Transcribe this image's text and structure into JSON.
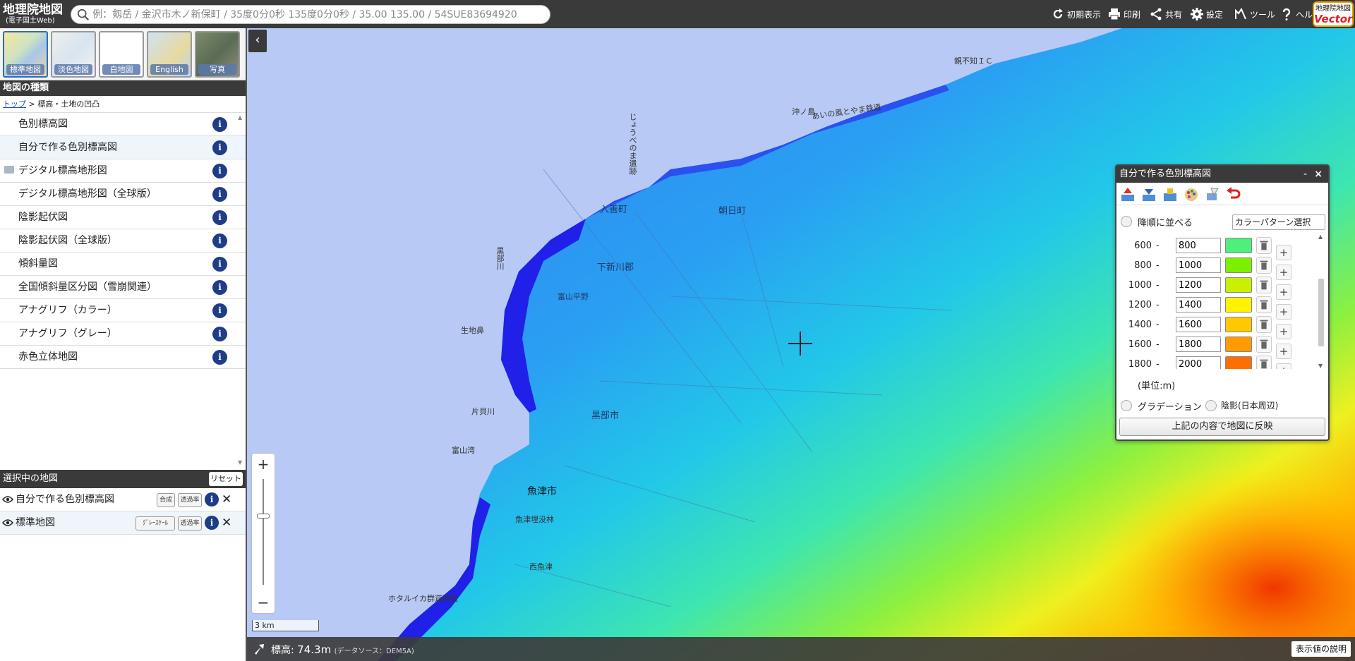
{
  "header": {
    "logo_line1": "地理院地図",
    "logo_line2": "(電子国土Web)",
    "search_placeholder": "例：剱岳 / 金沢市木ノ新保町 / 35度0分0秒 135度0分0秒 / 35.00 135.00 / 54SUE83694920",
    "buttons": [
      {
        "label": "初期表示",
        "icon": "reload-icon"
      },
      {
        "label": "印刷",
        "icon": "printer-icon"
      },
      {
        "label": "共有",
        "icon": "share-icon"
      },
      {
        "label": "設定",
        "icon": "gear-icon"
      },
      {
        "label": "ツール",
        "icon": "tools-icon"
      },
      {
        "label": "ヘルプ",
        "icon": "help-icon"
      }
    ],
    "vector_line1": "地理院地図",
    "vector_line2": "Vector"
  },
  "basemaps": [
    {
      "label": "標準地図",
      "active": true
    },
    {
      "label": "淡色地図",
      "active": false
    },
    {
      "label": "白地図",
      "active": false
    },
    {
      "label": "English",
      "active": false
    },
    {
      "label": "写真",
      "active": false
    }
  ],
  "maptype": {
    "header": "地図の種類",
    "breadcrumb_link": "トップ",
    "breadcrumb_rest": " > 標高・土地の凹凸",
    "items": [
      {
        "label": "色別標高図"
      },
      {
        "label": "自分で作る色別標高図"
      },
      {
        "label": "デジタル標高地形図"
      },
      {
        "label": "デジタル標高地形図（全球版）"
      },
      {
        "label": "陰影起伏図"
      },
      {
        "label": "陰影起伏図（全球版）"
      },
      {
        "label": "傾斜量図"
      },
      {
        "label": "全国傾斜量区分図（雪崩関連）"
      },
      {
        "label": "アナグリフ（カラー）"
      },
      {
        "label": "アナグリフ（グレー）"
      },
      {
        "label": "赤色立体地図"
      }
    ],
    "info_glyph": "i"
  },
  "selected": {
    "header": "選択中の地図",
    "reset_label": "リセット",
    "rows": [
      {
        "label": "自分で作る色別標高図",
        "btn1": "合成",
        "btn2": "透過率"
      },
      {
        "label": "標準地図",
        "btn1": "ｸﾞﾚｰｽｹｰﾙ",
        "btn2": "透過率"
      }
    ],
    "close_glyph": "✕"
  },
  "map": {
    "labels": [
      "親不知ＩＣ",
      "沖ノ島",
      "あいの風とやま鉄道",
      "じょうべのま遺跡",
      "入善町",
      "朝日町",
      "下新川郡",
      "富山平野",
      "黒部川",
      "生地鼻",
      "片貝川",
      "黒部市",
      "富山湾",
      "魚津市",
      "魚津埋没林",
      "西魚津",
      "ホタルイカ群遊海面"
    ],
    "scale_label": "3 km",
    "collapse_glyph": "‹"
  },
  "zoom": {
    "plus": "+",
    "minus": "−"
  },
  "status": {
    "label": "標高:",
    "value": "74.3m",
    "source": "(データソース：DEM5A)",
    "explain_label": "表示値の説明"
  },
  "dialog": {
    "title": "自分で作る色別標高図",
    "minimize": "-",
    "close": "×",
    "tool_icons": [
      "upload-icon",
      "download-icon",
      "copy-icon",
      "palette-icon",
      "eraser-icon",
      "undo-icon"
    ],
    "sort_label": "降順に並べる",
    "pattern_label": "カラーパターン選択",
    "rows": [
      {
        "from": "600",
        "to": "800",
        "color": "#4df07a"
      },
      {
        "from": "800",
        "to": "1000",
        "color": "#7df000"
      },
      {
        "from": "1000",
        "to": "1200",
        "color": "#c8f000"
      },
      {
        "from": "1200",
        "to": "1400",
        "color": "#fff200"
      },
      {
        "from": "1400",
        "to": "1600",
        "color": "#ffc800"
      },
      {
        "from": "1600",
        "to": "1800",
        "color": "#ff9b00"
      },
      {
        "from": "1800",
        "to": "2000",
        "color": "#ff6e00"
      }
    ],
    "unit_label": "(単位:m)",
    "gradation_label": "グラデーション",
    "shade_label": "陰影(日本周辺)",
    "apply_label": "上記の内容で地図に反映"
  }
}
